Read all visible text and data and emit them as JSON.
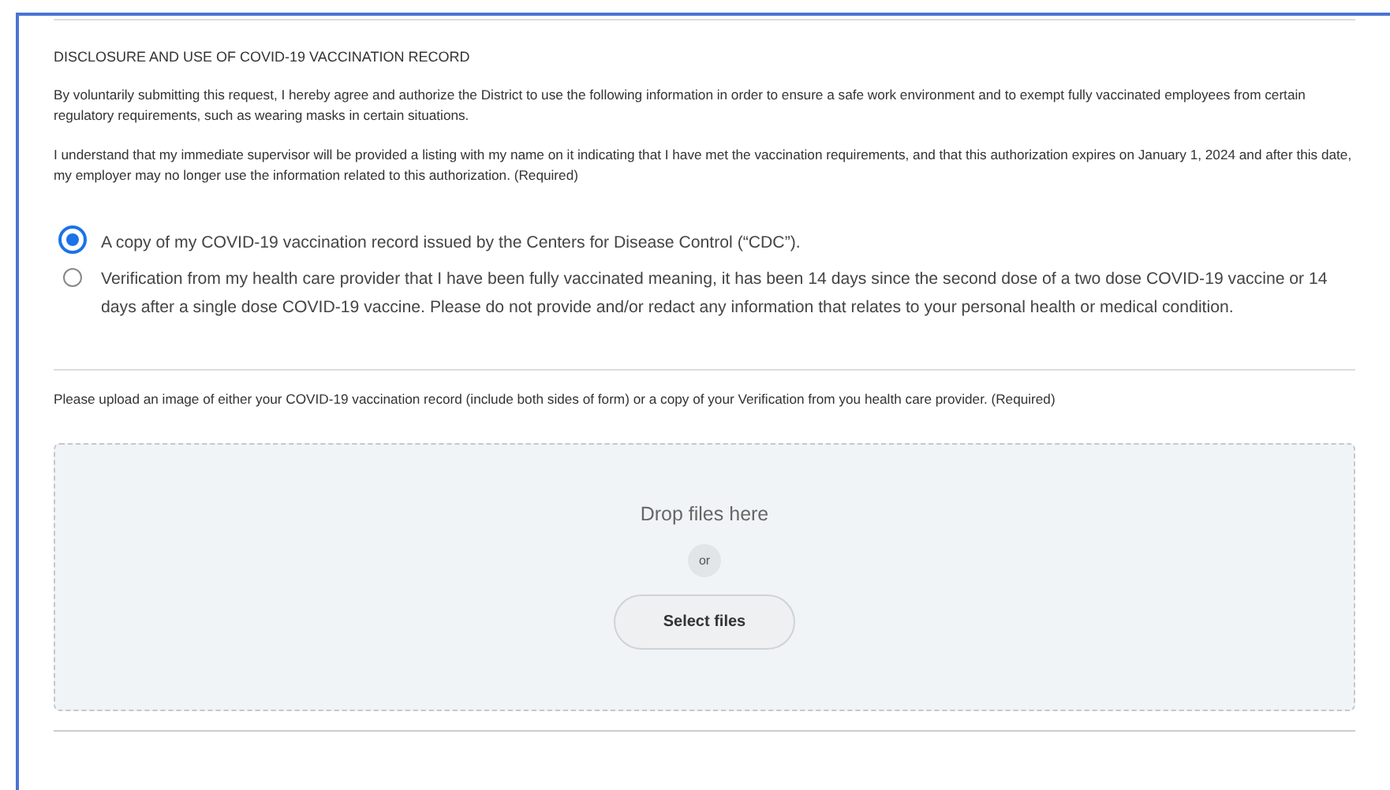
{
  "section_title": "DISCLOSURE AND USE OF COVID-19 VACCINATION RECORD",
  "paragraphs": [
    "By voluntarily submitting this request, I hereby agree and authorize the District to use the following information in order to ensure a safe work environment and to exempt fully vaccinated employees from certain regulatory requirements, such as wearing masks in certain situations.",
    "I understand that my immediate supervisor will be provided a listing with my name on it indicating that I have met the vaccination requirements, and that this authorization expires on January 1, 2024 and after this date, my employer may no longer use the information related to this authorization. (Required)"
  ],
  "options": [
    {
      "label": "A copy of my COVID-19 vaccination record issued by the Centers for Disease Control (“CDC”).",
      "selected": true
    },
    {
      "label": "Verification from my health care provider that I have been fully vaccinated meaning, it has been 14 days since the second dose of a two dose COVID-19 vaccine or 14 days after a single dose COVID-19 vaccine. Please do not provide and/or redact any information that relates to your personal health or medical condition.",
      "selected": false
    }
  ],
  "upload": {
    "prompt": "Please upload an image of either your COVID-19 vaccination record (include both sides of form) or a copy of your Verification from you health care provider. (Required)",
    "drop_text": "Drop files here",
    "or_text": "or",
    "button": "Select files"
  }
}
